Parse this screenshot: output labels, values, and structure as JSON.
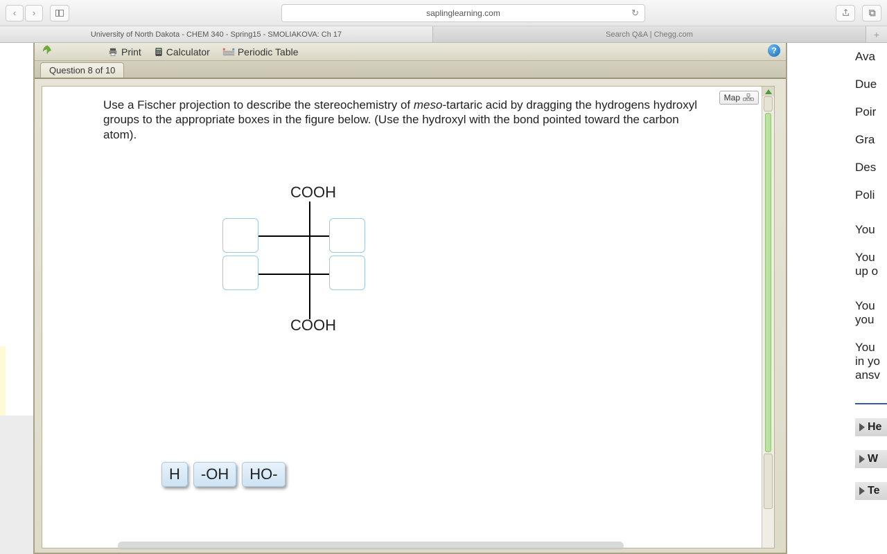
{
  "browser": {
    "url": "saplinglearning.com",
    "tabs": [
      {
        "label": "University of North Dakota - CHEM 340 - Spring15 - SMOLIAKOVA: Ch 17",
        "active": true
      },
      {
        "label": "Search Q&A | Chegg.com",
        "active": false
      }
    ]
  },
  "app_toolbar": {
    "print": "Print",
    "calculator": "Calculator",
    "periodic": "Periodic Table",
    "help_symbol": "?"
  },
  "question_tab": "Question 8 of 10",
  "map_button": "Map",
  "question": {
    "pre": "Use a Fischer projection to describe the stereochemistry of ",
    "meso": "meso",
    "post": "-tartaric acid by dragging the hydrogens hydroxyl groups to the appropriate boxes in the figure below. (Use the hydroxyl with the bond pointed toward the carbon atom)."
  },
  "fischer": {
    "top": "COOH",
    "bottom": "COOH"
  },
  "tokens": [
    "H",
    "-OH",
    "HO-"
  ],
  "right_col": {
    "lines": [
      "Ava",
      "Due",
      "Poir",
      "Gra",
      "Des",
      "Poli",
      "You",
      "You\nup o",
      "You\nyou",
      "You\nin yo\nansv"
    ],
    "sections": [
      "He",
      "W",
      "Te"
    ]
  }
}
